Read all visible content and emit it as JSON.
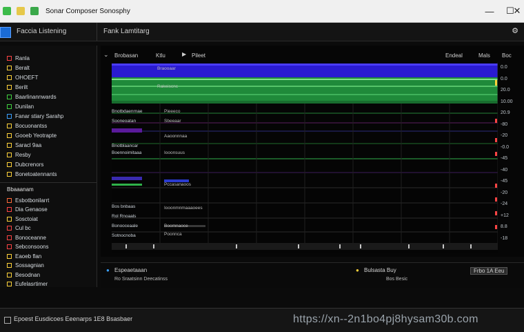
{
  "window": {
    "title": "Sonar Composer Sonosphy",
    "minimize": "—",
    "maximize": "☐",
    "close": "✕"
  },
  "menubar": {
    "left_label": "Faccia Listening",
    "right_label": "Fank Lamtitarg",
    "gear": "⚙"
  },
  "sidebar": {
    "items": [
      {
        "label": "Ranla",
        "color": "#ff4444"
      },
      {
        "label": "Beralt",
        "color": "#ffd23a"
      },
      {
        "label": "OHOEFT",
        "color": "#ffd23a"
      },
      {
        "label": "Berilt",
        "color": "#ffd23a"
      },
      {
        "label": "Baarlinannwards",
        "color": "#40d040"
      },
      {
        "label": "Dunilan",
        "color": "#40d040"
      },
      {
        "label": "Fanar stiary Sarahp",
        "color": "#3aa0ff"
      },
      {
        "label": "Bocuonantss",
        "color": "#ffd23a"
      },
      {
        "label": "Gooeb Yeotrapte",
        "color": "#ffd23a"
      },
      {
        "label": "Saracl 9aa",
        "color": "#ffd23a"
      },
      {
        "label": "Resby",
        "color": "#ffd23a"
      },
      {
        "label": "Dubcrenors",
        "color": "#ffd23a"
      },
      {
        "label": "Bonetoatennants",
        "color": "#ffd23a"
      }
    ],
    "section_title": "Bbaaanam",
    "section_items": [
      {
        "label": "Esbotbonilarrt",
        "color": "#ff6a3a"
      },
      {
        "label": "Dia Genaose",
        "color": "#ff4444"
      },
      {
        "label": "Sosctoiat",
        "color": "#ffd23a"
      },
      {
        "label": "Cul bc",
        "color": "#ff4444"
      },
      {
        "label": "Bonoceanne",
        "color": "#ff4444"
      },
      {
        "label": "Sebconsoons",
        "color": "#ff4444"
      },
      {
        "label": "Eaoeb flan",
        "color": "#ffd23a"
      },
      {
        "label": "Sossagnian",
        "color": "#ffd23a"
      },
      {
        "label": "Besodnan",
        "color": "#ffd23a"
      },
      {
        "label": "Eufelasrtimer",
        "color": "#ffd23a"
      }
    ]
  },
  "main": {
    "header": {
      "col1": "Brobasan",
      "col2": "Ktlu",
      "col3": "Pileet",
      "right1": "Endeal",
      "right2": "Mals",
      "right3": "Boc"
    },
    "row_labels": [
      "Bnotbdaenrnae",
      "Sooneoatan",
      "Bnotblaancar",
      "Boennoimitaaa",
      "Bos bnbaas",
      "Rol Rnoaals",
      "Bonooceaale",
      "Sotnocnoba"
    ],
    "inner_labels": [
      "Braooaar",
      "Rakeiscnc",
      "Pieeeco",
      "Sbeeaar",
      "Aaoonnnaa",
      "Iooonsuus",
      "Pccasanaoos",
      "Iooonmnmaaaoees",
      "Boomnaoce",
      "Poonnca"
    ],
    "scale": [
      "0.0",
      "0.0",
      "20.0",
      "10.00",
      "20.9",
      "-80",
      "-20",
      "-0.0",
      "-45",
      "-40",
      "-45",
      "-20",
      "-24",
      "+12",
      "8.8",
      "-18"
    ]
  },
  "bottom_panel": {
    "left_label": "Espeaetaaan",
    "left_sub": "Ro Sraatsinn Deecatinss",
    "mid_label": "Bulsasta Buy",
    "mid_sub": "Bos Besic",
    "right_box": "Frbo 1A Eeu"
  },
  "statusbar": {
    "text": "Epoest Eusdicoes Eeenarps 1E8 Bsasbaer",
    "url": "https://xn--2n1bo4pj8hysam30b.com"
  },
  "colors": {
    "blue_band": "#2a1bd0",
    "green_band": "#2fb24a",
    "accent_blue": "#1a6bd6"
  }
}
